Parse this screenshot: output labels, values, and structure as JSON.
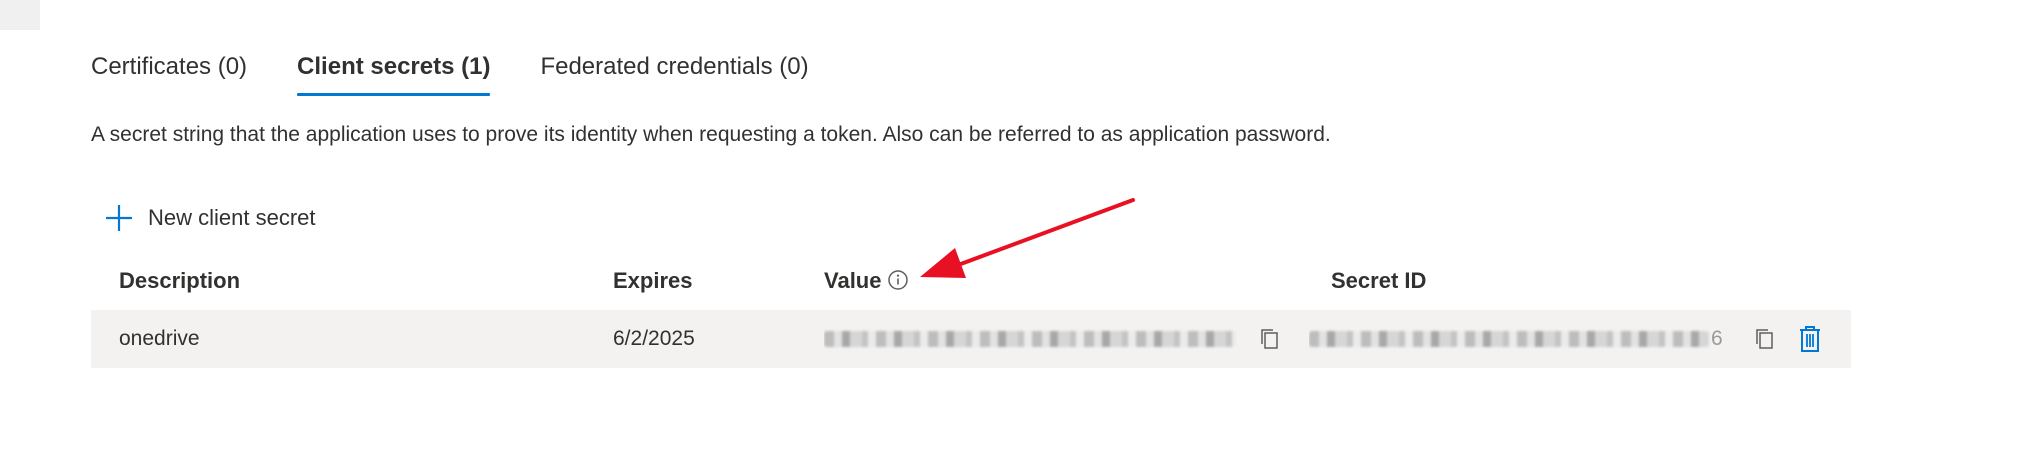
{
  "tabs": [
    {
      "label": "Certificates (0)",
      "selected": false
    },
    {
      "label": "Client secrets (1)",
      "selected": true
    },
    {
      "label": "Federated credentials (0)",
      "selected": false
    }
  ],
  "description": "A secret string that the application uses to prove its identity when requesting a token. Also can be referred to as application password.",
  "toolbar": {
    "new_secret_label": "New client secret"
  },
  "table": {
    "headers": {
      "description": "Description",
      "expires": "Expires",
      "value": "Value",
      "secret_id": "Secret ID"
    },
    "rows": [
      {
        "description": "onedrive",
        "expires": "6/2/2025",
        "value": "(redacted)",
        "secret_id": "(redacted)",
        "secret_id_visible_suffix": "6"
      }
    ]
  },
  "colors": {
    "accent": "#0078d4",
    "annotation_arrow": "#e81123",
    "row_bg": "#f3f2f1"
  },
  "icons": [
    "plus-icon",
    "info-icon",
    "copy-icon",
    "delete-icon"
  ]
}
